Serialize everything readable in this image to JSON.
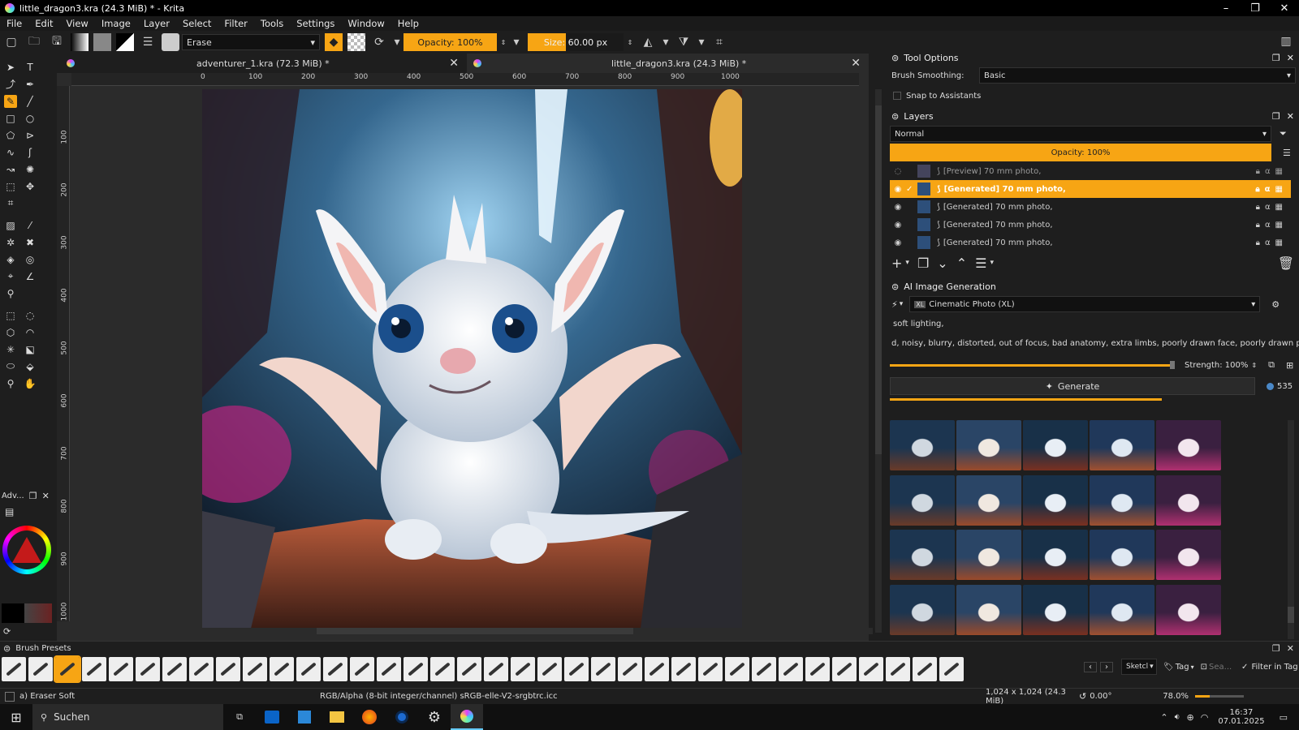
{
  "window": {
    "title": "little_dragon3.kra (24.3 MiB) * - Krita"
  },
  "menu": [
    "File",
    "Edit",
    "View",
    "Image",
    "Layer",
    "Select",
    "Filter",
    "Tools",
    "Settings",
    "Window",
    "Help"
  ],
  "toolbar": {
    "blend_mode": "Erase",
    "opacity": "Opacity: 100%",
    "size": "Size: 60.00 px"
  },
  "tabs": [
    {
      "label": "adventurer_1.kra (72.3 MiB) *"
    },
    {
      "label": "little_dragon3.kra (24.3 MiB) *"
    }
  ],
  "ruler_h": [
    "0",
    "100",
    "200",
    "300",
    "400",
    "500",
    "600",
    "700",
    "800",
    "900",
    "1000"
  ],
  "ruler_v": [
    "100",
    "200",
    "300",
    "400",
    "500",
    "600",
    "700",
    "800",
    "900",
    "1000"
  ],
  "tool_options": {
    "title": "Tool Options",
    "brush_smoothing_label": "Brush Smoothing:",
    "brush_smoothing_value": "Basic",
    "snap_label": "Snap to Assistants"
  },
  "layers": {
    "title": "Layers",
    "blend": "Normal",
    "opacity": "Opacity:  100%",
    "items": [
      {
        "name": "[Preview] 70 mm photo,"
      },
      {
        "name": "[Generated] 70 mm photo,"
      },
      {
        "name": "[Generated] 70 mm photo,"
      },
      {
        "name": "[Generated] 70 mm photo,"
      },
      {
        "name": "[Generated] 70 mm photo,"
      }
    ]
  },
  "ai": {
    "title": "AI Image Generation",
    "style": "Cinematic Photo (XL)",
    "style_badge": "XL",
    "prompt": "soft lighting,",
    "negative": "d,  noisy,  blurry,  distorted,  out of focus,  bad anatomy,  extra limbs,  poorly drawn face,  poorly drawn paws",
    "strength": "Strength: 100%",
    "generate": "Generate",
    "count": "535",
    "progress": 0.87
  },
  "docker_left": {
    "title": "Adv..."
  },
  "brush_presets": {
    "title": "Brush Presets",
    "tag_combo": "Sketcl",
    "tag": "Tag",
    "search_placeholder": "Sea...",
    "filter": "Filter in Tag"
  },
  "status": {
    "brush": "a) Eraser Soft",
    "color": "RGB/Alpha (8-bit integer/channel)  sRGB-elle-V2-srgbtrc.icc",
    "dims": "1,024 x 1,024 (24.3 MiB)",
    "rotation": "0.00°",
    "zoom": "78.0%"
  },
  "taskbar": {
    "search": "Suchen",
    "time": "16:37",
    "date": "07.01.2025"
  }
}
